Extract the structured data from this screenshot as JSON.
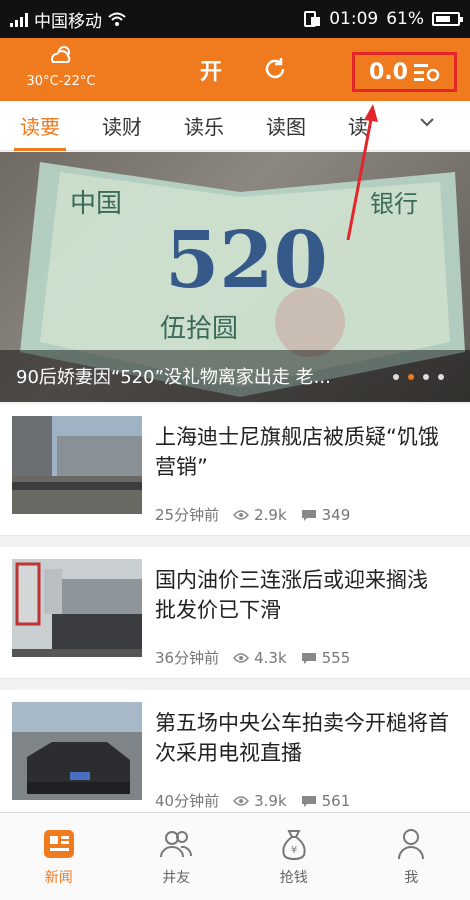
{
  "status_bar": {
    "carrier": "中国移动",
    "time": "01:09",
    "battery": "61%"
  },
  "header": {
    "weather_temp": "30°C-22°C",
    "brand": "开",
    "coins": "0.0"
  },
  "tabs": [
    {
      "label": "读要"
    },
    {
      "label": "读财"
    },
    {
      "label": "读乐"
    },
    {
      "label": "读图"
    },
    {
      "label": "读"
    }
  ],
  "hero": {
    "caption": "90后娇妻因“520”没礼物离家出走 老..."
  },
  "news": [
    {
      "title": "上海迪士尼旗舰店被质疑“饥饿营销”",
      "time": "25分钟前",
      "views": "2.9k",
      "comments": "349"
    },
    {
      "title": "国内油价三连涨后或迎来搁浅 批发价已下滑",
      "time": "36分钟前",
      "views": "4.3k",
      "comments": "555"
    },
    {
      "title": "第五场中央公车拍卖今开槌将首次采用电视直播",
      "time": "40分钟前",
      "views": "3.9k",
      "comments": "561"
    }
  ],
  "bottom_nav": [
    {
      "label": "新闻"
    },
    {
      "label": "井友"
    },
    {
      "label": "抢钱"
    },
    {
      "label": "我"
    }
  ],
  "colors": {
    "accent": "#f07a1e",
    "annotation_red": "#e2262a"
  }
}
